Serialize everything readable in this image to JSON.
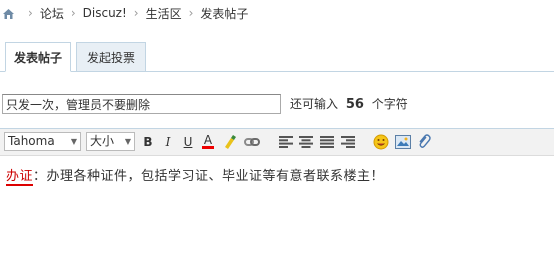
{
  "breadcrumb": {
    "items": [
      "论坛",
      "Discuz!",
      "生活区",
      "发表帖子"
    ],
    "separator": "›"
  },
  "tabs": [
    {
      "label": "发表帖子",
      "active": true
    },
    {
      "label": "发起投票",
      "active": false
    }
  ],
  "subject": {
    "value": "只发一次，管理员不要删除",
    "remaining_prefix": "还可输入",
    "remaining_count": "56",
    "remaining_suffix": "个字符"
  },
  "toolbar": {
    "font_select": "Tahoma",
    "size_select": "大小",
    "bold": "B",
    "italic": "I",
    "underline": "U",
    "font_color": "A"
  },
  "content": {
    "highlight": "办证",
    "text": "：办理各种证件，包括学习证、毕业证等有意者联系楼主！"
  },
  "colors": {
    "tab_border": "#c2d5e3",
    "tab_inactive_bg": "#e8eff5",
    "toolbar_bg": "#f2f2f2",
    "highlight_red": "#cc0000"
  }
}
